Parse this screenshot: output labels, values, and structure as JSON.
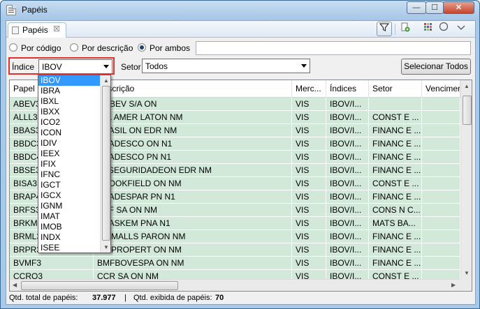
{
  "window": {
    "title": "Papéis",
    "minimize": "—",
    "maximize": "☐",
    "close": "✕"
  },
  "view": {
    "tab_label": "Papéis",
    "tab_close": "☒"
  },
  "toolbar_icons": [
    "filter-icon",
    "document-add-icon",
    "grid-color-icon",
    "circle-icon",
    "view-menu-icon"
  ],
  "search": {
    "options": [
      {
        "label": "Por código",
        "checked": false
      },
      {
        "label": "Por descrição",
        "checked": false
      },
      {
        "label": "Por ambos",
        "checked": true
      }
    ],
    "value": ""
  },
  "filters": {
    "indice_label": "Índice",
    "indice_value": "IBOV",
    "setor_label": "Setor",
    "setor_value": "Todos",
    "select_all_label": "Selecionar Todos"
  },
  "table": {
    "columns": [
      "Papel",
      "Descrição",
      "Merc...",
      "Índices",
      "Setor",
      "Vencimer"
    ],
    "rows": [
      [
        "ABEV3",
        "AMBEV S/A ON",
        "VIS",
        "IBOV/I...",
        ""
      ],
      [
        "ALLL3",
        "ALL AMER LATON NM",
        "VIS",
        "IBOV/I...",
        "CONST E ..."
      ],
      [
        "BBAS3",
        "BRASIL ON EDR NM",
        "VIS",
        "IBOV/I...",
        "FINANC E ..."
      ],
      [
        "BBDC3",
        "BRADESCO ON N1",
        "VIS",
        "IBOV/I...",
        "FINANC E ..."
      ],
      [
        "BBDC4",
        "BRADESCO PN N1",
        "VIS",
        "IBOV/I...",
        "FINANC E ..."
      ],
      [
        "BBSE3",
        "BBSEGURIDADEON EDR NM",
        "VIS",
        "IBOV/I...",
        "FINANC E ..."
      ],
      [
        "BISA3",
        "BROOKFIELD ON NM",
        "VIS",
        "IBOV/I...",
        "CONST E ..."
      ],
      [
        "BRAP4",
        "BRADESPAR PN N1",
        "VIS",
        "IBOV/I...",
        "FINANC E ..."
      ],
      [
        "BRFS3",
        "BRF SA ON NM",
        "VIS",
        "IBOV/I...",
        "CONS N C..."
      ],
      [
        "BRKM5",
        "BRASKEM PNA N1",
        "VIS",
        "IBOV/I...",
        "MATS BA..."
      ],
      [
        "BRML3",
        "BR MALLS PARON NM",
        "VIS",
        "IBOV/I...",
        "FINANC E ..."
      ],
      [
        "BRPR3",
        "BR PROPERT ON NM",
        "VIS",
        "IBOV/I...",
        "FINANC E ..."
      ],
      [
        "BVMF3",
        "BMFBOVESPA ON NM",
        "VIS",
        "IBOV/I...",
        "FINANC E ..."
      ],
      [
        "CCRO3",
        "CCR SA ON NM",
        "VIS",
        "IBOV/I...",
        "CONST E ..."
      ]
    ]
  },
  "dropdown": {
    "items": [
      "IBOV",
      "IBRA",
      "IBXL",
      "IBXX",
      "ICO2",
      "ICON",
      "IDIV",
      "IEEX",
      "IFIX",
      "IFNC",
      "IGCT",
      "IGCX",
      "IGNM",
      "IMAT",
      "IMOB",
      "INDX",
      "ISEE"
    ],
    "selected_index": 0
  },
  "status": {
    "total_label": "Qtd. total de papéis:",
    "total_value": "37.977",
    "separator": "|",
    "shown_label": "Qtd. exibida de papéis:",
    "shown_value": "70"
  }
}
